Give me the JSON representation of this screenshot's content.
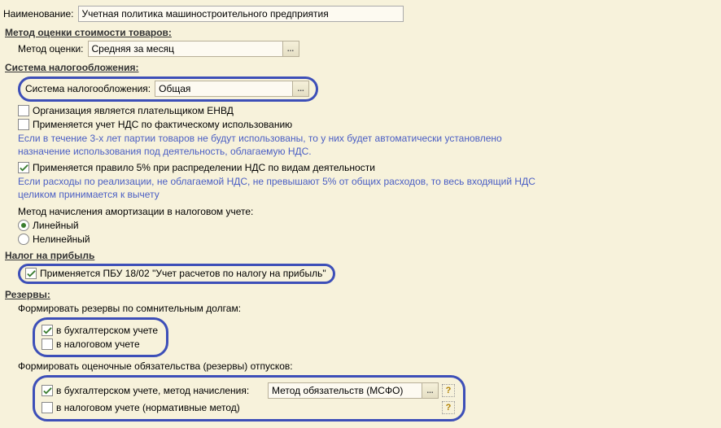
{
  "name_label": "Наименование:",
  "name_value": "Учетная политика машиностроительного предприятия",
  "method_section": "Метод оценки стоимости товаров:",
  "method_label": "Метод оценки:",
  "method_value": "Средняя за месяц",
  "tax_system_section": "Система налогообложения:",
  "tax_system_label": "Система налогообложения:",
  "tax_system_value": "Общая",
  "chk_envd": "Организация является плательщиком ЕНВД",
  "chk_nds_fact": "Применяется учет НДС по фактическому использованию",
  "info_3years": "Если в течение 3-х лет партии товаров не будут использованы, то у них будет автоматически установлено назначение использования под деятельность, облагаемую НДС.",
  "chk_5percent": "Применяется правило 5% при распределении НДС по видам деятельности",
  "info_5percent": "Если расходы по реализации, не облагаемой НДС, не превышают 5% от общих расходов, то весь входящий НДС целиком принимается к вычету",
  "amort_label": "Метод начисления амортизации в налоговом учете:",
  "radio_linear": "Линейный",
  "radio_nonlinear": "Нелинейный",
  "profit_section": "Налог на прибыль",
  "chk_pbu1802": "Применяется ПБУ 18/02 \"Учет расчетов по налогу на прибыль\"",
  "reserves_section": "Резервы:",
  "reserves_doubtful": "Формировать резервы по сомнительным долгам:",
  "chk_bu": "в бухгалтерском учете",
  "chk_nu": "в налоговом учете",
  "reserves_vacation": "Формировать оценочные обязательства (резервы) отпусков:",
  "chk_bu_method": "в бухгалтерском учете, метод начисления:",
  "method_obligations": "Метод обязательств (МСФО)",
  "chk_nu_norm": "в налоговом учете (нормативные метод)",
  "ellipsis": "...",
  "help": "?"
}
